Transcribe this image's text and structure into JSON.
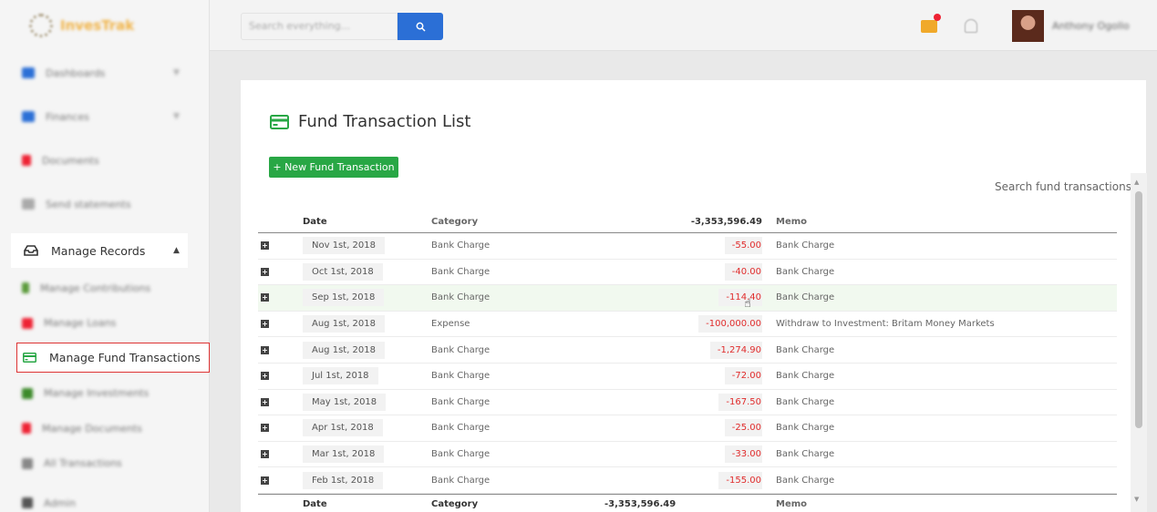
{
  "brand": {
    "name": "InvesTrak",
    "accent": "#28a745"
  },
  "topbar": {
    "search_placeholder": "Search everything...",
    "search_button_icon": "search-icon",
    "user_name": "Anthony Ogollo"
  },
  "sidebar": {
    "items": [
      {
        "label": "Dashboards",
        "icon": "dashboard-icon",
        "color": "#2b6fd6"
      },
      {
        "label": "Finances",
        "icon": "finance-icon",
        "color": "#2b6fd6"
      },
      {
        "label": "Documents",
        "icon": "document-icon",
        "color": "#e23"
      },
      {
        "label": "Send statements",
        "icon": "send-icon",
        "color": "#999"
      }
    ],
    "manage_records": "Manage Records",
    "sub_items": [
      {
        "label": "Manage Contributions",
        "color": "#5a9a3a"
      },
      {
        "label": "Manage Loans",
        "color": "#e23"
      },
      {
        "label": "Manage Fund Transactions",
        "color": "#28a745"
      },
      {
        "label": "Manage Investments",
        "color": "#5a9a3a"
      },
      {
        "label": "Manage Documents",
        "color": "#e23"
      },
      {
        "label": "All Transactions",
        "color": "#999"
      }
    ],
    "admin": "Admin"
  },
  "main": {
    "title": "Fund Transaction List",
    "new_button": "+ New Fund Transaction",
    "search_label": "Search fund transactions",
    "columns": {
      "date": "Date",
      "category": "Category",
      "amount_total": "-3,353,596.49",
      "memo": "Memo"
    },
    "rows": [
      {
        "date": "Nov 1st, 2018",
        "category": "Bank Charge",
        "amount": "-55.00",
        "memo": "Bank Charge"
      },
      {
        "date": "Oct 1st, 2018",
        "category": "Bank Charge",
        "amount": "-40.00",
        "memo": "Bank Charge"
      },
      {
        "date": "Sep 1st, 2018",
        "category": "Bank Charge",
        "amount": "-114.40",
        "memo": "Bank Charge"
      },
      {
        "date": "Aug 1st, 2018",
        "category": "Expense",
        "amount": "-100,000.00",
        "memo": "Withdraw to Investment: Britam Money Markets"
      },
      {
        "date": "Aug 1st, 2018",
        "category": "Bank Charge",
        "amount": "-1,274.90",
        "memo": "Bank Charge"
      },
      {
        "date": "Jul 1st, 2018",
        "category": "Bank Charge",
        "amount": "-72.00",
        "memo": "Bank Charge"
      },
      {
        "date": "May 1st, 2018",
        "category": "Bank Charge",
        "amount": "-167.50",
        "memo": "Bank Charge"
      },
      {
        "date": "Apr 1st, 2018",
        "category": "Bank Charge",
        "amount": "-25.00",
        "memo": "Bank Charge"
      },
      {
        "date": "Mar 1st, 2018",
        "category": "Bank Charge",
        "amount": "-33.00",
        "memo": "Bank Charge"
      },
      {
        "date": "Feb 1st, 2018",
        "category": "Bank Charge",
        "amount": "-155.00",
        "memo": "Bank Charge"
      }
    ],
    "footer": {
      "date": "Date",
      "category": "Category",
      "amount_total": "-3,353,596.49",
      "memo": "Memo"
    }
  }
}
